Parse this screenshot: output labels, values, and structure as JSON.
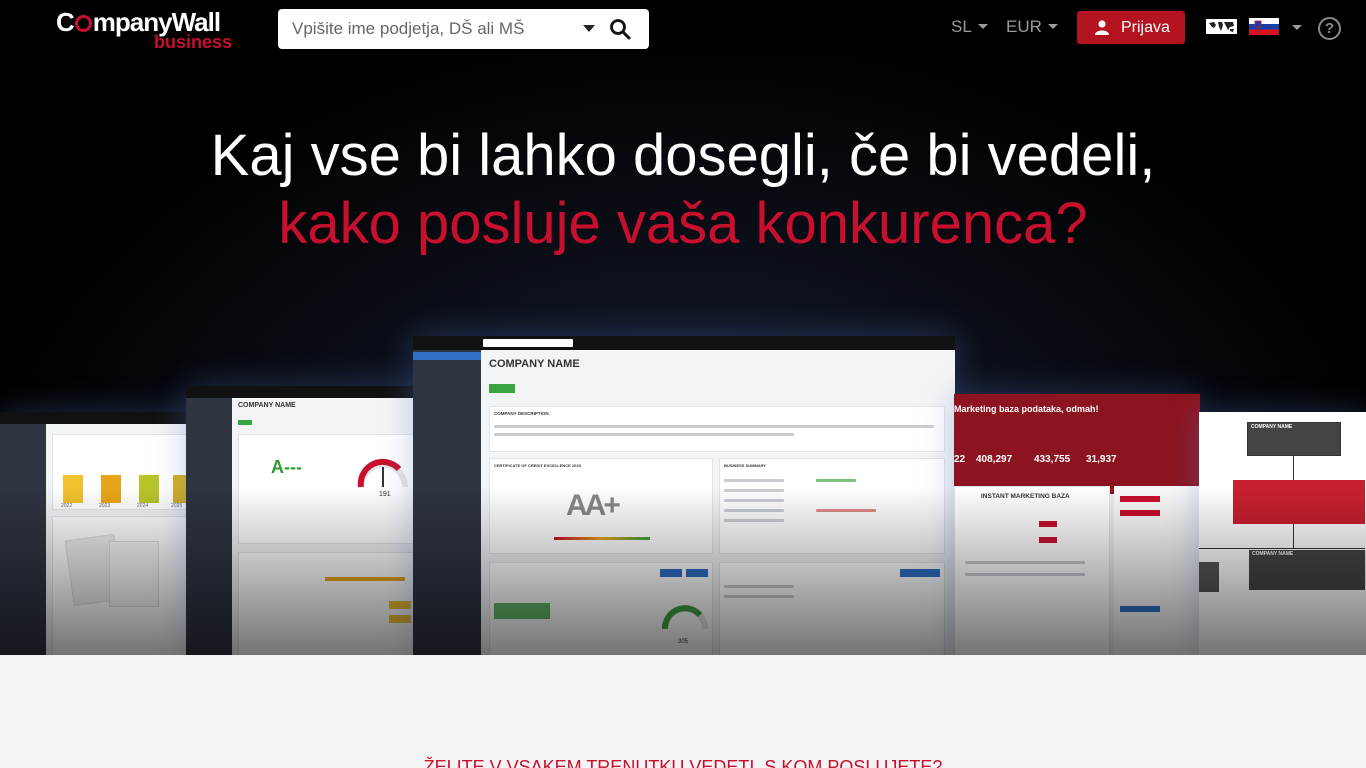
{
  "logo": {
    "brand_pre": "C",
    "brand_post": "mpanyWall",
    "sub": "business"
  },
  "search": {
    "placeholder": "Vpišite ime podjetja, DŠ ali MŠ"
  },
  "nav": {
    "language": "SL",
    "currency": "EUR",
    "login_label": "Prijava",
    "help": "?"
  },
  "hero": {
    "line1": "Kaj vse bi lahko dosegli, če bi vedeli,",
    "line2": "kako posluje vaša konkurenca?"
  },
  "screens": {
    "company_name": "COMPANY NAME",
    "rating_a": "A---",
    "rating_aa": "AA+",
    "gauge_value": "191",
    "gauge_value2": "305",
    "certificate_title": "CERTIFICATE OF CREDIT EXCELLENCE 2025",
    "company_description": "COMPANY DESCRIPTION",
    "business_summary": "BUSINESS SUMMARY",
    "marketing_title": "Marketing baza podataka, odmah!",
    "instant_marketing": "INSTANT MARKETING BAZA",
    "stats": [
      "22",
      "408,297",
      "433,755",
      "31,937"
    ],
    "years": [
      "2022",
      "2023",
      "2024",
      "2025"
    ],
    "tree_box": "COMPANY NAME"
  },
  "below": {
    "title": "ŽELITE V VSAKEM TRENUTKU VEDETI, S KOM POSLUJETE?"
  },
  "colors": {
    "brand_red": "#c8102e",
    "button_red": "#b3121f",
    "navbar": "#000000"
  }
}
